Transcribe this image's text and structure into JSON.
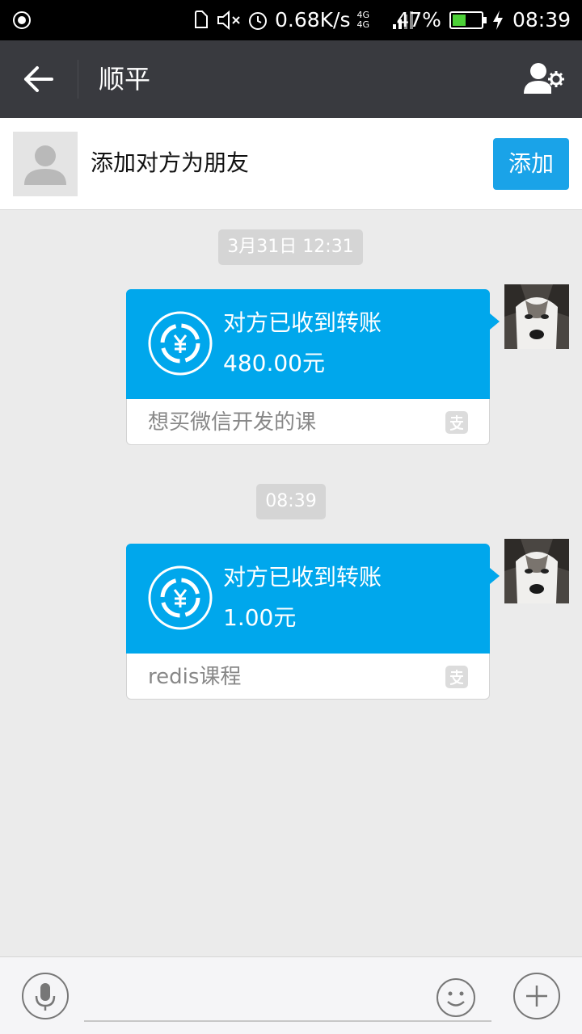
{
  "status_bar": {
    "speed": "0.68K/s",
    "network": "4G 4G",
    "battery": "47%",
    "battery_level": 0.47,
    "time": "08:39"
  },
  "header": {
    "title": "顺平"
  },
  "add_banner": {
    "text": "添加对方为朋友",
    "button_label": "添加"
  },
  "messages": [
    {
      "timestamp": "3月31日 12:31",
      "title": "对方已收到转账",
      "amount": "480.00元",
      "note": "想买微信开发的课"
    },
    {
      "timestamp": "08:39",
      "title": "对方已收到转账",
      "amount": "1.00元",
      "note": "redis课程"
    }
  ],
  "input": {
    "placeholder": ""
  },
  "colors": {
    "accent": "#00a7ec",
    "header_bg": "#393a3f",
    "chat_bg": "#ebebeb"
  },
  "icons": {
    "back": "arrow-left-icon",
    "profile": "user-settings-icon",
    "transfer": "yuan-exchange-icon",
    "alipay": "alipay-icon",
    "voice": "microphone-icon",
    "emoji": "smiley-icon",
    "more": "plus-icon"
  }
}
